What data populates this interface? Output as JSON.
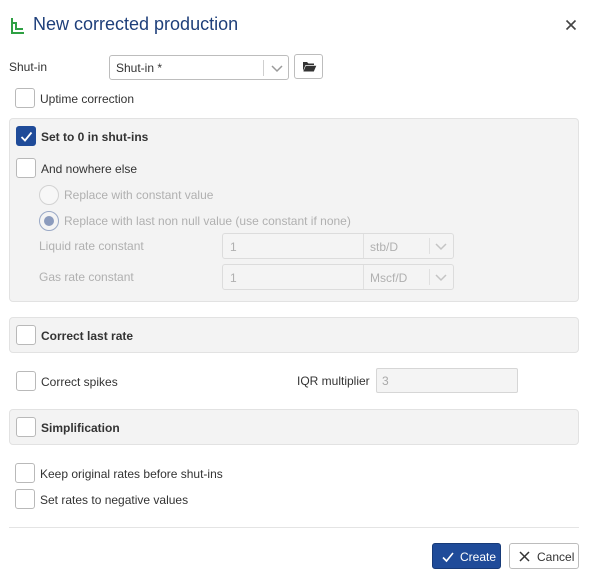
{
  "dialog": {
    "title": "New corrected production",
    "icons": {
      "title": "decline-curve-icon",
      "close": "close-icon"
    }
  },
  "shut_in": {
    "label": "Shut-in",
    "selected_value": "Shut-in *",
    "dropdown_icon": "chevron-down-icon",
    "browse_icon": "folder-open-icon"
  },
  "uptime_correction": {
    "label": "Uptime correction",
    "checked": false
  },
  "set_to_zero": {
    "label": "Set to 0 in shut-ins",
    "checked": true,
    "and_nowhere_else": {
      "label": "And nowhere else",
      "checked": false
    },
    "options": [
      {
        "label": "Replace with constant value",
        "selected": false,
        "enabled": false
      },
      {
        "label": "Replace with last non null value (use constant if none)",
        "selected": true,
        "enabled": false
      }
    ],
    "liquid_rate": {
      "label": "Liquid rate constant",
      "value": "1",
      "unit": "stb/D"
    },
    "gas_rate": {
      "label": "Gas rate constant",
      "value": "1",
      "unit": "Mscf/D"
    }
  },
  "correct_last_rate": {
    "label": "Correct last rate",
    "checked": false
  },
  "correct_spikes": {
    "label": "Correct spikes",
    "checked": false,
    "iqr_label": "IQR multiplier",
    "iqr_value": "3"
  },
  "simplification": {
    "label": "Simplification",
    "checked": false
  },
  "keep_original_rates": {
    "label": "Keep original rates before shut-ins",
    "checked": false
  },
  "negative_rates": {
    "label": "Set rates to negative values",
    "checked": false
  },
  "buttons": {
    "create": {
      "label": "Create",
      "icon": "check-icon"
    },
    "cancel": {
      "label": "Cancel",
      "icon": "x-icon"
    }
  },
  "colors": {
    "accent": "#1f4b99",
    "title": "#1e3f7a",
    "title_icon": "#2ea043",
    "panel_bg": "#f3f3f3",
    "disabled_text": "#b0b0b0"
  }
}
